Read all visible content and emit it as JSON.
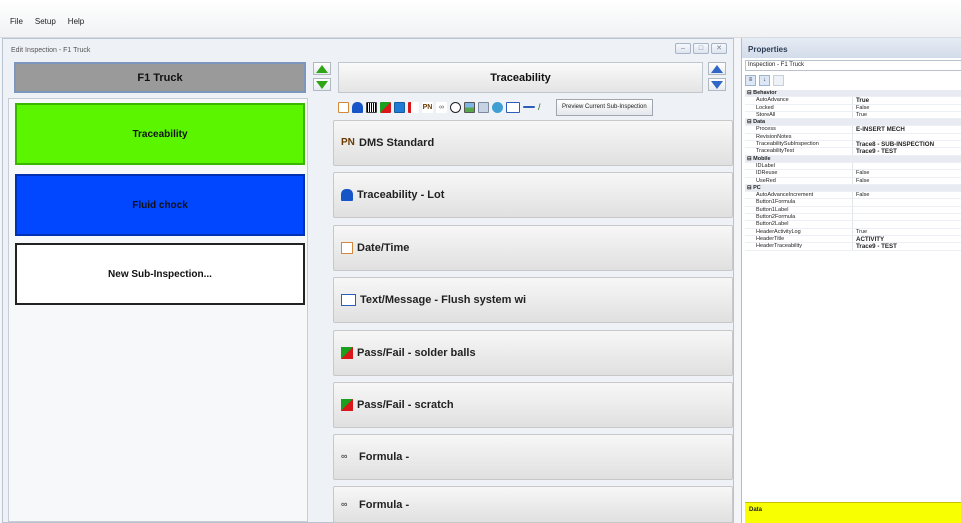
{
  "menu": [
    "File",
    "Setup",
    "Help"
  ],
  "editor": {
    "title": "Edit Inspection - F1 Truck",
    "window_buttons": [
      "–",
      "□",
      "✕"
    ],
    "left_header": "F1 Truck",
    "sub_inspections": [
      {
        "label": "Traceability",
        "color": "#5cf500"
      },
      {
        "label": "Fluid chock",
        "color": "#0047ff"
      },
      {
        "label": "New Sub-Inspection...",
        "color": "#ffffff"
      }
    ],
    "mid_header": "Traceability",
    "toolbar": {
      "icons": [
        "calendar-icon",
        "lot-icon",
        "barcode-icon",
        "passfail-icon",
        "checkbox-icon",
        "list-icon",
        "pn-icon",
        "formula-icon",
        "timer-icon",
        "image-icon",
        "photo-icon",
        "gauge-icon",
        "text-icon",
        "line-icon",
        "signature-icon"
      ],
      "preview_label": "Preview Current Sub-Inspection"
    },
    "items": [
      {
        "icon": "pn-icon",
        "label": "DMS Standard"
      },
      {
        "icon": "lot-icon",
        "label": "Traceability - Lot"
      },
      {
        "icon": "calendar-icon",
        "label": "Date/Time"
      },
      {
        "icon": "text-icon",
        "label": "Text/Message - Flush system wi"
      },
      {
        "icon": "passfail-icon",
        "label": "Pass/Fail - solder balls"
      },
      {
        "icon": "passfail-icon",
        "label": "Pass/Fail - scratch"
      },
      {
        "icon": "formula-icon",
        "label": "Formula -"
      },
      {
        "icon": "formula-icon",
        "label": "Formula -"
      }
    ]
  },
  "properties": {
    "title": "Properties",
    "object": "Inspection - F1 Truck",
    "rows": [
      {
        "type": "cat",
        "name": "Behavior"
      },
      {
        "name": "AutoAdvance",
        "value": "True",
        "bold": true
      },
      {
        "name": "Locked",
        "value": "False"
      },
      {
        "name": "StoreAll",
        "value": "True"
      },
      {
        "type": "cat",
        "name": "Data"
      },
      {
        "name": "Process",
        "value": "E-INSERT MECH",
        "bold": true
      },
      {
        "name": "RevisionNotes",
        "value": ""
      },
      {
        "name": "TraceabilitySubInspection",
        "value": "Trace8 - SUB-INSPECTION",
        "bold": true
      },
      {
        "name": "TraceabilityTest",
        "value": "Trace9 - TEST",
        "bold": true
      },
      {
        "type": "cat",
        "name": "Mobile"
      },
      {
        "name": "IDLabel",
        "value": ""
      },
      {
        "name": "IDReuse",
        "value": "False"
      },
      {
        "name": "UseRed",
        "value": "False"
      },
      {
        "type": "cat",
        "name": "PC"
      },
      {
        "name": "AutoAdvanceIncrement",
        "value": "False"
      },
      {
        "name": "Button1Formula",
        "value": ""
      },
      {
        "name": "Button1Label",
        "value": ""
      },
      {
        "name": "Button2Formula",
        "value": ""
      },
      {
        "name": "Button2Label",
        "value": ""
      },
      {
        "name": "HeaderActivityLog",
        "value": "True"
      },
      {
        "name": "HeaderTitle",
        "value": "ACTIVITY",
        "bold": true
      },
      {
        "name": "HeaderTraceability",
        "value": "Trace9 - TEST",
        "bold": true
      }
    ],
    "description": "Data"
  }
}
